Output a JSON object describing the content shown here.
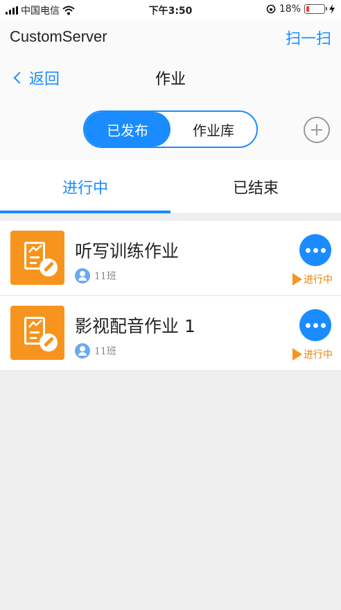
{
  "statusbar": {
    "carrier": "中国电信",
    "time": "下午3:50",
    "battery_percent": "18%",
    "battery_level": 0.18,
    "icons": [
      "signal-icon",
      "wifi-icon",
      "rotation-lock-icon",
      "battery-icon",
      "charging-icon"
    ]
  },
  "topbar": {
    "app_name": "CustomServer",
    "scan_label": "扫一扫"
  },
  "nav": {
    "back_label": "返回",
    "title": "作业"
  },
  "segment": {
    "published": "已发布",
    "library": "作业库",
    "selected": "已发布"
  },
  "tabs": {
    "in_progress": "进行中",
    "ended": "已结束",
    "selected": "进行中"
  },
  "assignments": [
    {
      "title": "听写训练作业",
      "class_name": "11班",
      "status": "进行中"
    },
    {
      "title": "影视配音作业 1",
      "class_name": "11班",
      "status": "进行中"
    }
  ],
  "colors": {
    "accent": "#1a8cff",
    "icon_bg": "#f7941e",
    "status": "#e6820c"
  }
}
